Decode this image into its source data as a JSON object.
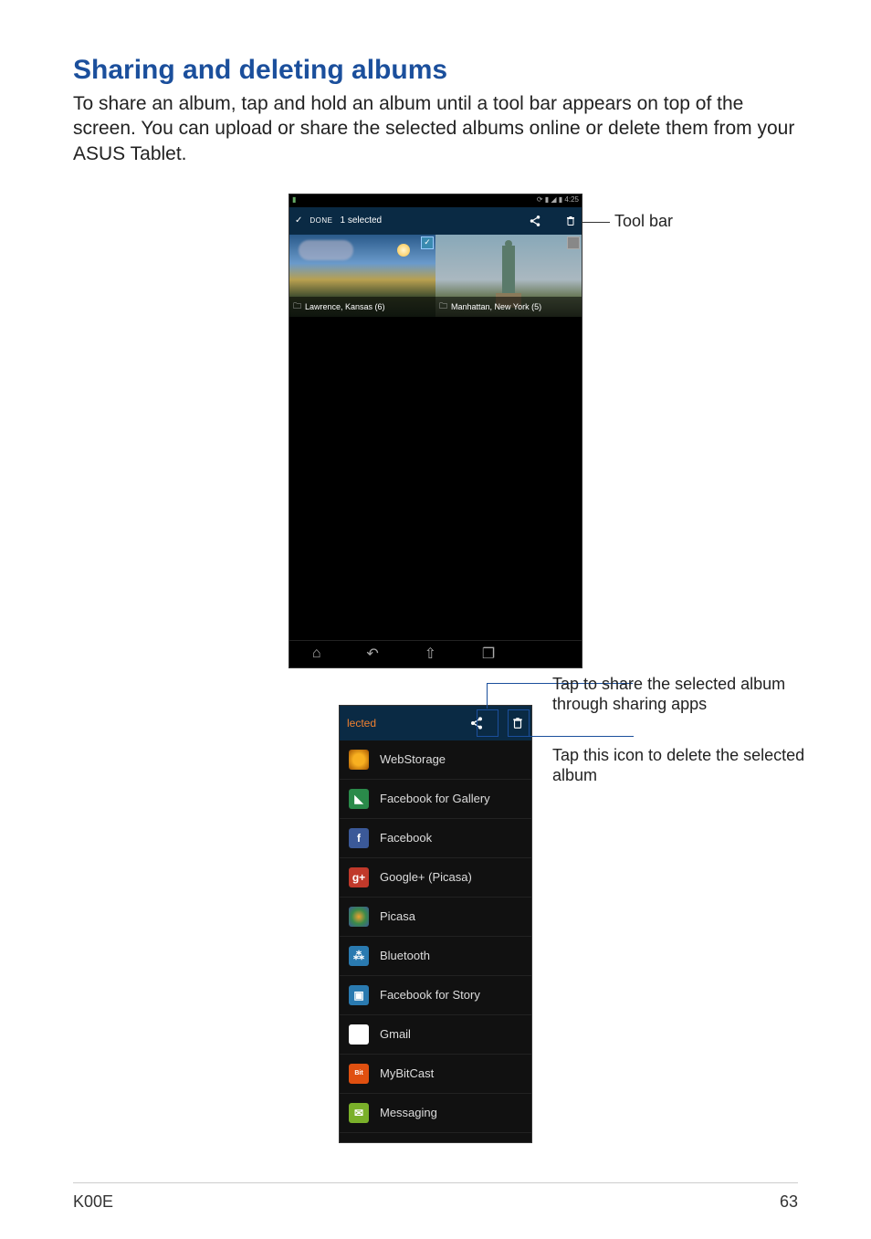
{
  "heading": "Sharing and deleting albums",
  "body": "To share an album, tap and hold an album until a tool bar appears on top of the screen. You can upload or share the selected albums online or delete them from your ASUS Tablet.",
  "figure1": {
    "status_time": "4:25",
    "toolbar": {
      "done": "DONE",
      "selected": "1 selected"
    },
    "albums": [
      {
        "name": "Lawrence, Kansas (6)",
        "selected": true
      },
      {
        "name": "Manhattan, New York (5)",
        "selected": false
      }
    ],
    "callout_toolbar": "Tool bar"
  },
  "figure2": {
    "top_left_text": "lected",
    "items": [
      "WebStorage",
      "Facebook for Gallery",
      "Facebook",
      "Google+ (Picasa)",
      "Picasa",
      "Bluetooth",
      "Facebook for Story",
      "Gmail",
      "MyBitCast",
      "Messaging"
    ],
    "callout_share": "Tap to share the selected album through sharing apps",
    "callout_delete": "Tap this icon to delete the selected album"
  },
  "footer": {
    "model": "K00E",
    "page": "63"
  }
}
